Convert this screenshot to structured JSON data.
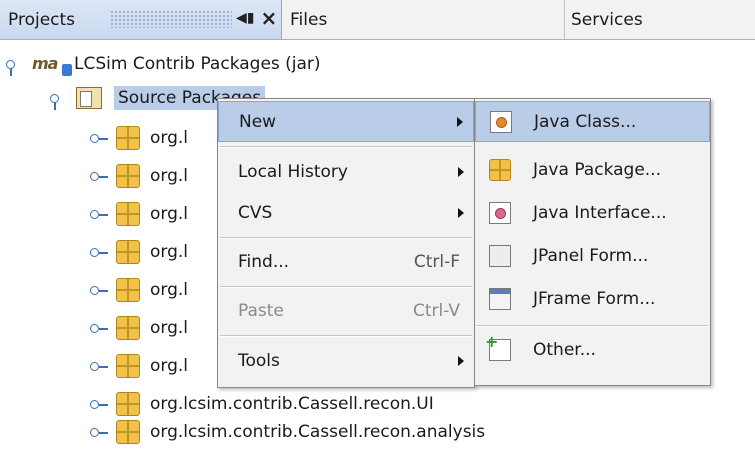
{
  "tabs": {
    "projects": "Projects",
    "files": "Files",
    "services": "Services"
  },
  "tree": {
    "root_label": "LCSim Contrib Packages (jar)",
    "source_packages_label": "Source Packages",
    "packages": [
      "org.l",
      "org.l",
      "org.l",
      "org.l",
      "org.l",
      "org.l",
      "org.l",
      "org.lcsim.contrib.Cassell.recon.UI",
      "org.lcsim.contrib.Cassell.recon.analysis"
    ]
  },
  "context_menu": {
    "new": "New",
    "local_history": "Local History",
    "cvs": "CVS",
    "find": "Find...",
    "find_shortcut": "Ctrl-F",
    "paste": "Paste",
    "paste_shortcut": "Ctrl-V",
    "tools": "Tools"
  },
  "new_submenu": {
    "java_class": "Java Class...",
    "java_package": "Java Package...",
    "java_interface": "Java Interface...",
    "jpanel_form": "JPanel Form...",
    "jframe_form": "JFrame Form...",
    "other": "Other..."
  }
}
